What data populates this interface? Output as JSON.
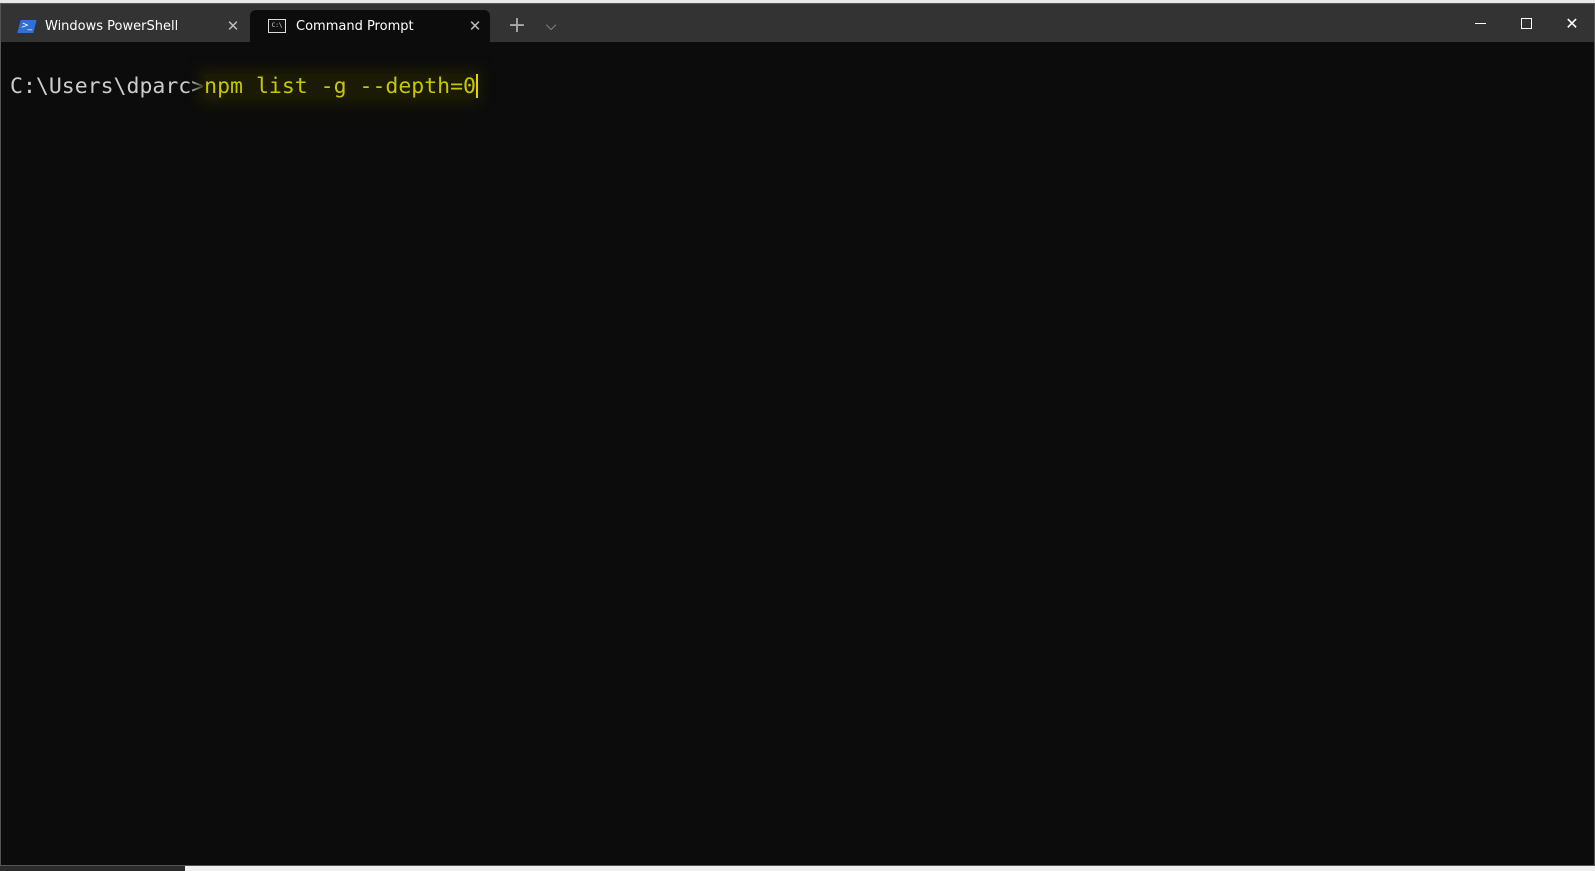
{
  "tabs": [
    {
      "label": "Windows PowerShell",
      "icon": "powershell-icon",
      "active": false
    },
    {
      "label": "Command Prompt",
      "icon": "cmd-icon",
      "active": true
    }
  ],
  "tab_bar": {
    "new_tab": "+",
    "dropdown": "⌵",
    "close": "✕"
  },
  "window_controls": {
    "close": "✕"
  },
  "terminal": {
    "prompt": "C:\\Users\\dparc>",
    "command": "npm list -g --depth=0"
  },
  "colors": {
    "terminal_bg": "#0c0c0c",
    "tabbar_bg": "#333333",
    "command_text": "#c8c800"
  }
}
